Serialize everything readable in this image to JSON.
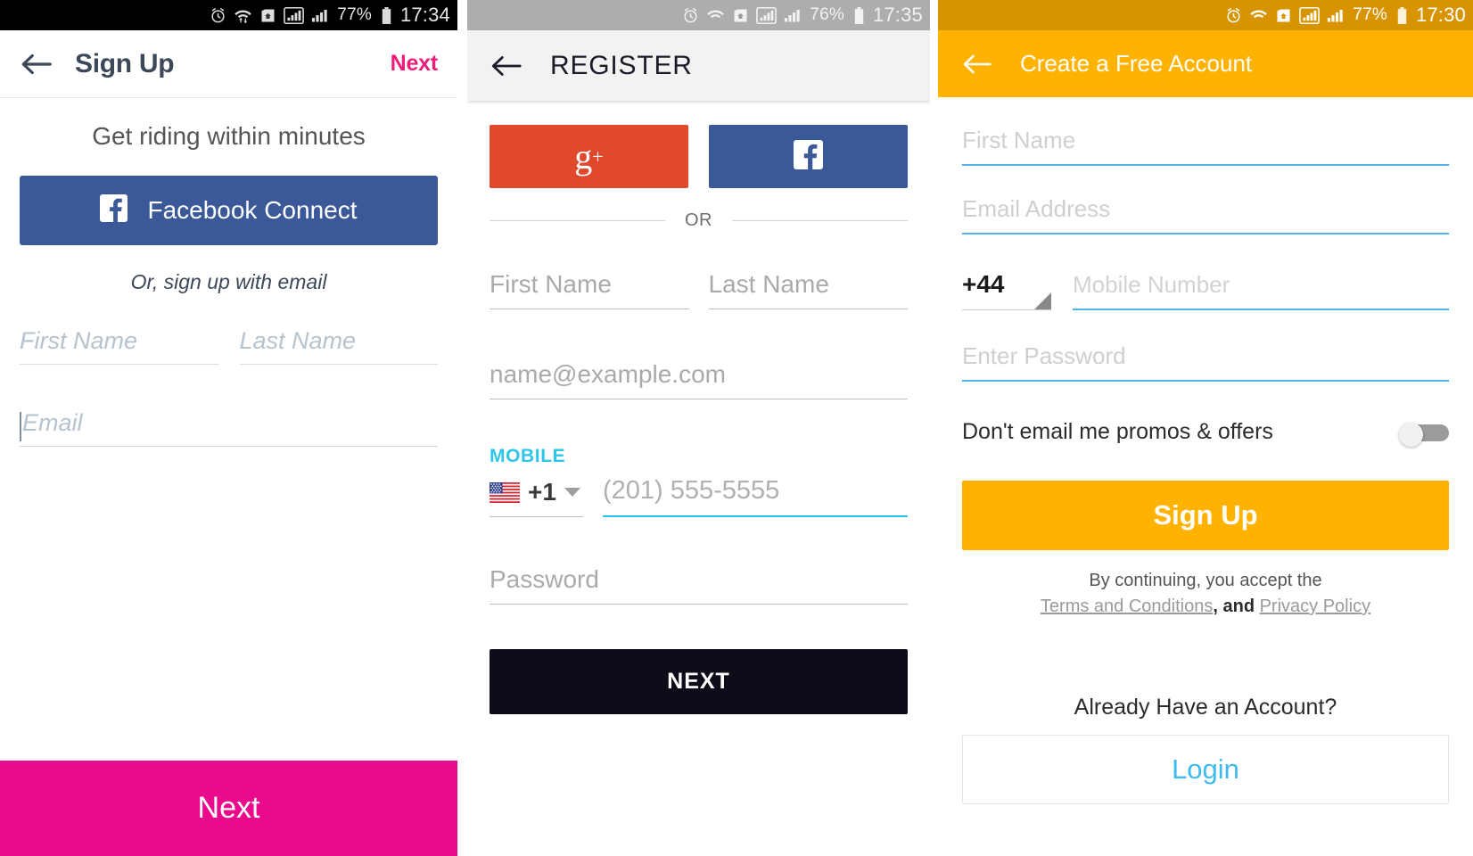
{
  "panels": [
    {
      "id": "signup-app",
      "status_bar": {
        "battery": "77%",
        "time": "17:34",
        "icons": [
          "alarm-icon",
          "wifi-icon",
          "home-icon",
          "signal-1-icon",
          "signal-2-icon",
          "battery-icon"
        ]
      },
      "appbar": {
        "title": "Sign Up",
        "back": "back-arrow",
        "action": "Next"
      },
      "tagline": "Get riding within minutes",
      "facebook_button": "Facebook Connect",
      "or_text": "Or, sign up with email",
      "fields": [
        {
          "name": "first-name",
          "placeholder": "First Name",
          "value": ""
        },
        {
          "name": "last-name",
          "placeholder": "Last Name",
          "value": ""
        },
        {
          "name": "email",
          "placeholder": "Email",
          "value": ""
        }
      ],
      "primary_button": "Next",
      "colors": {
        "accent": "#ea0a8c",
        "facebook": "#3b5999",
        "title": "#3c4858"
      }
    },
    {
      "id": "register-app",
      "status_bar": {
        "battery": "76%",
        "time": "17:35",
        "icons": [
          "alarm-icon",
          "wifi-icon",
          "home-icon",
          "signal-1-icon",
          "signal-2-icon",
          "battery-icon"
        ]
      },
      "appbar": {
        "title": "REGISTER",
        "back": "back-arrow"
      },
      "social": [
        {
          "name": "google-plus-button",
          "glyph": "g+"
        },
        {
          "name": "facebook-button",
          "glyph": "f"
        }
      ],
      "divider_text": "OR",
      "fields": [
        {
          "name": "first-name",
          "placeholder": "First Name",
          "value": ""
        },
        {
          "name": "last-name",
          "placeholder": "Last Name",
          "value": ""
        },
        {
          "name": "email",
          "placeholder": "name@example.com",
          "value": ""
        },
        {
          "name": "password",
          "placeholder": "Password",
          "value": ""
        }
      ],
      "mobile_label": "MOBILE",
      "country_code": "+1",
      "country_flag": "us-flag-icon",
      "phone_placeholder": "(201) 555-5555",
      "primary_button": "NEXT",
      "colors": {
        "google": "#e0492c",
        "facebook": "#3b5998",
        "mobile_label": "#2ec6e8",
        "underline_active": "#29c2ef",
        "next": "#0d0d1a"
      }
    },
    {
      "id": "create-account-app",
      "status_bar": {
        "battery": "77%",
        "time": "17:30",
        "icons": [
          "alarm-icon",
          "wifi-icon",
          "home-icon",
          "signal-1-icon",
          "signal-2-icon",
          "battery-icon"
        ]
      },
      "appbar": {
        "title": "Create a Free Account",
        "back": "back-arrow"
      },
      "fields": [
        {
          "name": "first-name",
          "placeholder": "First Name",
          "value": ""
        },
        {
          "name": "email-address",
          "placeholder": "Email Address",
          "value": ""
        },
        {
          "name": "mobile-number",
          "placeholder": "Mobile Number",
          "value": ""
        },
        {
          "name": "password",
          "placeholder": "Enter Password",
          "value": ""
        }
      ],
      "country_code": "+44",
      "toggle": {
        "label": "Don't email me promos & offers",
        "state": "off"
      },
      "primary_button": "Sign Up",
      "terms": {
        "line1": "By continuing, you accept the",
        "terms_link": "Terms and Conditions",
        "conjunction": ", and ",
        "privacy_link": "Privacy Policy"
      },
      "already_account": "Already Have an Account?",
      "login_button": "Login",
      "colors": {
        "brand": "#ffb300",
        "statusbar": "#d79400",
        "underline": "#4fb3ec",
        "login_text": "#3dbbf0"
      }
    }
  ]
}
